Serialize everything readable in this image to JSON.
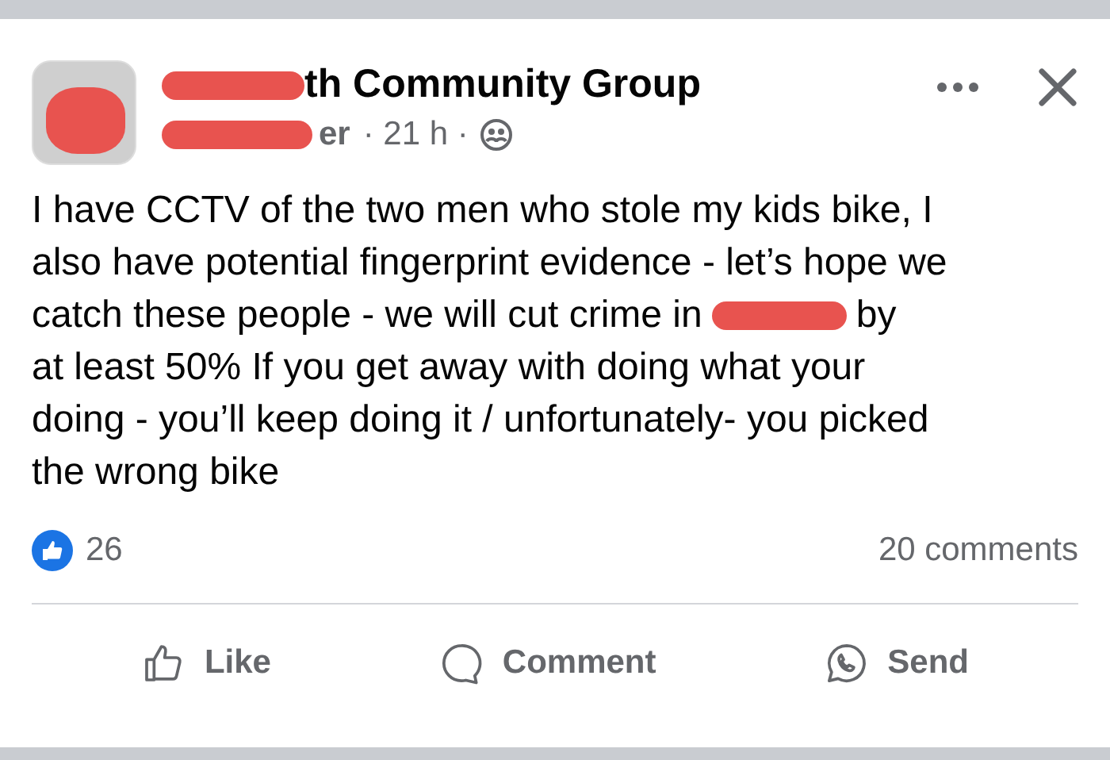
{
  "post": {
    "group_name": "th Community Group",
    "author": "er",
    "time": "· 21 h ·",
    "body": [
      {
        "text": "I have CCTV of the two men who stole my kids bike, I"
      },
      {
        "text": "also have potential fingerprint evidence - let’s hope we"
      },
      {
        "text": "catch these people - we will cut crime in",
        "text_after": "by"
      },
      {
        "text": "at least 50% If you get away with doing what your"
      },
      {
        "text": "doing - you’ll keep doing it / unfortunately- you picked"
      },
      {
        "text": "the wrong bike"
      }
    ]
  },
  "stats": {
    "reactions": "26",
    "comments": "20 comments"
  },
  "actions": [
    {
      "kind": "like",
      "label": "Like"
    },
    {
      "kind": "comment",
      "label": "Comment"
    },
    {
      "kind": "send",
      "label": "Send"
    }
  ]
}
